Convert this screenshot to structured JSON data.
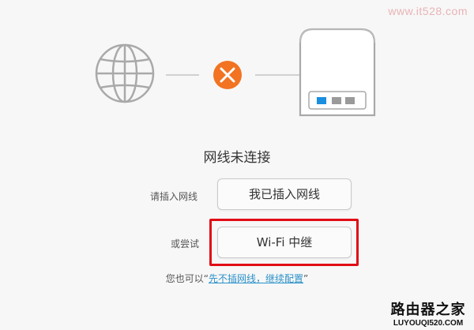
{
  "watermark": "www.it528.com",
  "status": {
    "title": "网线未连接"
  },
  "actions": {
    "plug_label": "请插入网线",
    "plug_button": "我已插入网线",
    "or_label": "或尝试",
    "relay_button": "Wi-Fi 中继"
  },
  "hint": {
    "prefix": "您也可以",
    "open_quote": "“",
    "link": "先不插网线，继续配置",
    "close_quote": "”"
  },
  "brand": {
    "name": "路由器之家",
    "url": "LUYOUQI520.COM"
  },
  "icons": {
    "globe": "globe-icon",
    "disconnect": "x-circle-icon",
    "router": "router-icon"
  },
  "colors": {
    "accent_orange": "#f27321",
    "port_blue": "#1a8fe0",
    "highlight_red": "#e10c16",
    "link_blue": "#2c91c9"
  }
}
